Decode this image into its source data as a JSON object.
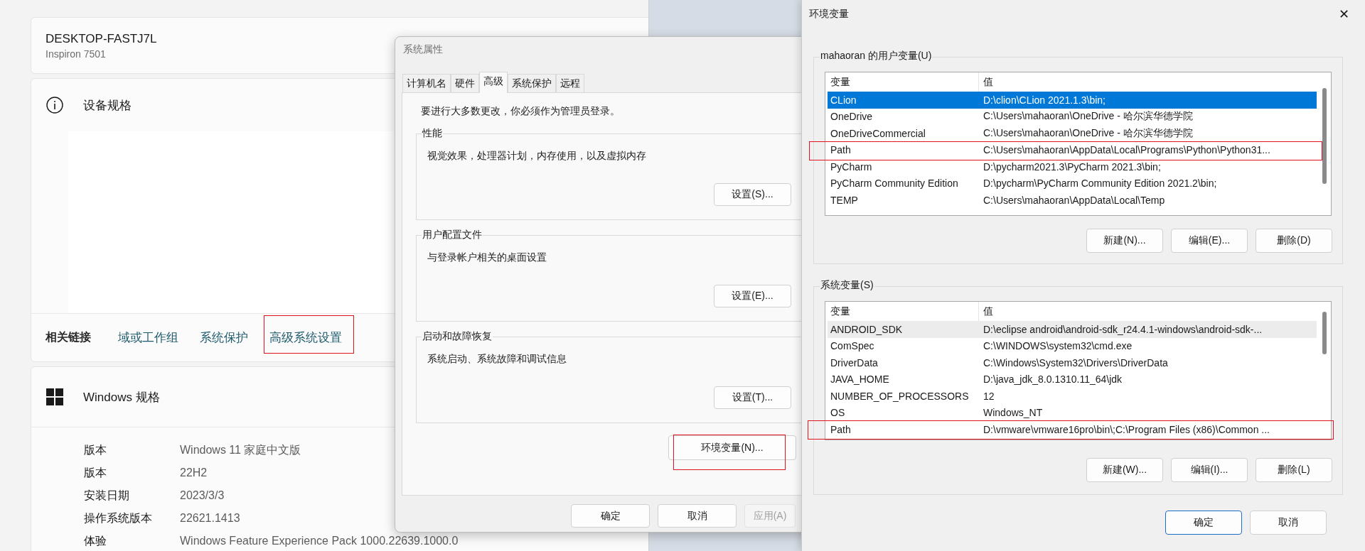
{
  "settings_page": {
    "device": {
      "name": "DESKTOP-FASTJ7L",
      "model": "Inspiron 7501"
    },
    "device_specs": {
      "title": "设备规格"
    },
    "related_links": {
      "label": "相关链接",
      "links": [
        {
          "label": "域或工作组",
          "highlighted": false
        },
        {
          "label": "系统保护",
          "highlighted": false
        },
        {
          "label": "高级系统设置",
          "highlighted": true
        }
      ]
    },
    "windows_specs": {
      "title": "Windows 规格",
      "rows": [
        {
          "label": "版本",
          "value": "Windows 11 家庭中文版"
        },
        {
          "label": "版本",
          "value": "22H2"
        },
        {
          "label": "安装日期",
          "value": "2023/3/3"
        },
        {
          "label": "操作系统版本",
          "value": "22621.1413"
        },
        {
          "label": "体验",
          "value": "Windows Feature Experience Pack 1000.22639.1000.0"
        }
      ]
    }
  },
  "system_properties": {
    "title": "系统属性",
    "tabs": [
      {
        "label": "计算机名",
        "selected": false
      },
      {
        "label": "硬件",
        "selected": false
      },
      {
        "label": "高级",
        "selected": true
      },
      {
        "label": "系统保护",
        "selected": false
      },
      {
        "label": "远程",
        "selected": false
      }
    ],
    "notice": "要进行大多数更改，你必须作为管理员登录。",
    "groups": [
      {
        "title": "性能",
        "description": "视觉效果，处理器计划，内存使用，以及虚拟内存",
        "button": "设置(S)..."
      },
      {
        "title": "用户配置文件",
        "description": "与登录帐户相关的桌面设置",
        "button": "设置(E)..."
      },
      {
        "title": "启动和故障恢复",
        "description": "系统启动、系统故障和调试信息",
        "button": "设置(T)..."
      }
    ],
    "env_button": {
      "label": "环境变量(N)...",
      "highlighted": true
    },
    "buttons": [
      {
        "label": "确定",
        "disabled": false
      },
      {
        "label": "取消",
        "disabled": false
      },
      {
        "label": "应用(A)",
        "disabled": true
      }
    ]
  },
  "environment_variables": {
    "title": "环境变量",
    "close": "✕",
    "user_vars": {
      "title": "mahaoran 的用户变量(U)",
      "focused": true,
      "columns": [
        "变量",
        "值"
      ],
      "rows": [
        {
          "name": "CLion",
          "value": "D:\\clion\\CLion 2021.1.3\\bin;",
          "selected": true,
          "highlighted": false
        },
        {
          "name": "OneDrive",
          "value": "C:\\Users\\mahaoran\\OneDrive - 哈尔滨华德学院",
          "selected": false,
          "highlighted": false
        },
        {
          "name": "OneDriveCommercial",
          "value": "C:\\Users\\mahaoran\\OneDrive - 哈尔滨华德学院",
          "selected": false,
          "highlighted": false
        },
        {
          "name": "Path",
          "value": "C:\\Users\\mahaoran\\AppData\\Local\\Programs\\Python\\Python31...",
          "selected": false,
          "highlighted": true
        },
        {
          "name": "PyCharm",
          "value": "D:\\pycharm2021.3\\PyCharm 2021.3\\bin;",
          "selected": false,
          "highlighted": false
        },
        {
          "name": "PyCharm Community Edition",
          "value": "D:\\pycharm\\PyCharm Community Edition 2021.2\\bin;",
          "selected": false,
          "highlighted": false
        },
        {
          "name": "TEMP",
          "value": "C:\\Users\\mahaoran\\AppData\\Local\\Temp",
          "selected": false,
          "highlighted": false
        }
      ],
      "buttons": [
        "新建(N)...",
        "编辑(E)...",
        "删除(D)"
      ]
    },
    "system_vars": {
      "title": "系统变量(S)",
      "focused": false,
      "columns": [
        "变量",
        "值"
      ],
      "rows": [
        {
          "name": "ANDROID_SDK",
          "value": "D:\\eclipse android\\android-sdk_r24.4.1-windows\\android-sdk-...",
          "selected": true,
          "highlighted": false
        },
        {
          "name": "ComSpec",
          "value": "C:\\WINDOWS\\system32\\cmd.exe",
          "selected": false,
          "highlighted": false
        },
        {
          "name": "DriverData",
          "value": "C:\\Windows\\System32\\Drivers\\DriverData",
          "selected": false,
          "highlighted": false
        },
        {
          "name": "JAVA_HOME",
          "value": "D:\\java_jdk_8.0.1310.11_64\\jdk",
          "selected": false,
          "highlighted": false
        },
        {
          "name": "NUMBER_OF_PROCESSORS",
          "value": "12",
          "selected": false,
          "highlighted": false
        },
        {
          "name": "OS",
          "value": "Windows_NT",
          "selected": false,
          "highlighted": false
        },
        {
          "name": "Path",
          "value": "D:\\vmware\\vmware16pro\\bin\\;C:\\Program Files (x86)\\Common ...",
          "selected": false,
          "highlighted": true
        }
      ],
      "buttons": [
        "新建(W)...",
        "编辑(I)...",
        "删除(L)"
      ]
    },
    "buttons": [
      {
        "label": "确定",
        "default": true
      },
      {
        "label": "取消",
        "default": false
      }
    ]
  }
}
